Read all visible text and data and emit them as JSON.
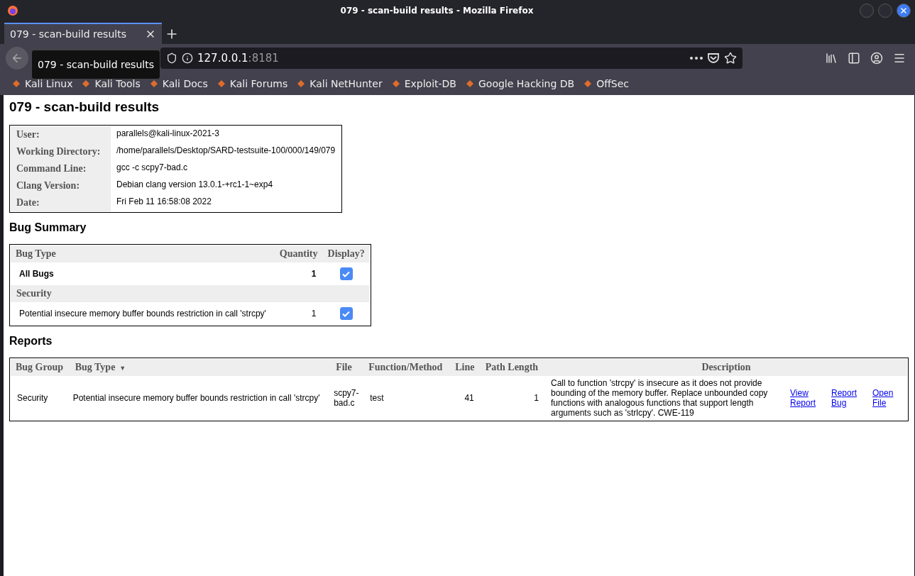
{
  "window": {
    "title": "079 - scan-build results - Mozilla Firefox"
  },
  "tabs": [
    {
      "label": "079 - scan-build results",
      "selected": true
    }
  ],
  "tooltip": "079 - scan-build results",
  "address": {
    "host": "127.0.0.1",
    "port": ":8181"
  },
  "bookmarks": [
    "Kali Linux",
    "Kali Tools",
    "Kali Docs",
    "Kali Forums",
    "Kali NetHunter",
    "Exploit-DB",
    "Google Hacking DB",
    "OffSec"
  ],
  "page": {
    "heading": "079 - scan-build results",
    "info": [
      {
        "label": "User:",
        "value": "parallels@kali-linux-2021-3"
      },
      {
        "label": "Working Directory:",
        "value": "/home/parallels/Desktop/SARD-testsuite-100/000/149/079"
      },
      {
        "label": "Command Line:",
        "value": "gcc -c scpy7-bad.c"
      },
      {
        "label": "Clang Version:",
        "value": "Debian clang version 13.0.1-+rc1-1~exp4"
      },
      {
        "label": "Date:",
        "value": "Fri Feb 11 16:58:08 2022"
      }
    ],
    "summary": {
      "heading": "Bug Summary",
      "columns": [
        "Bug Type",
        "Quantity",
        "Display?"
      ],
      "rows": [
        {
          "kind": "total",
          "label": "All Bugs",
          "quantity": "1",
          "checked": true
        },
        {
          "kind": "group",
          "label": "Security"
        },
        {
          "kind": "bug",
          "label": "Potential insecure memory buffer bounds restriction in call 'strcpy'",
          "quantity": "1",
          "checked": true
        }
      ]
    },
    "reports": {
      "heading": "Reports",
      "columns": [
        {
          "label": "Bug Group"
        },
        {
          "label": "Bug Type",
          "sort_indicator": "▼"
        },
        {
          "label": "File"
        },
        {
          "label": "Function/Method"
        },
        {
          "label": "Line"
        },
        {
          "label": "Path Length"
        },
        {
          "label": "Description"
        }
      ],
      "rows": [
        {
          "bug_group": "Security",
          "bug_type": "Potential insecure memory buffer bounds restriction in call 'strcpy'",
          "file": "scpy7-bad.c",
          "function": "test",
          "line": "41",
          "path_length": "1",
          "description": "Call to function 'strcpy' is insecure as it does not provide bounding of the memory buffer. Replace unbounded copy functions with analogous functions that support length arguments such as 'strlcpy'. CWE-119",
          "links": [
            "View Report",
            "Report Bug",
            "Open File"
          ]
        }
      ]
    }
  }
}
